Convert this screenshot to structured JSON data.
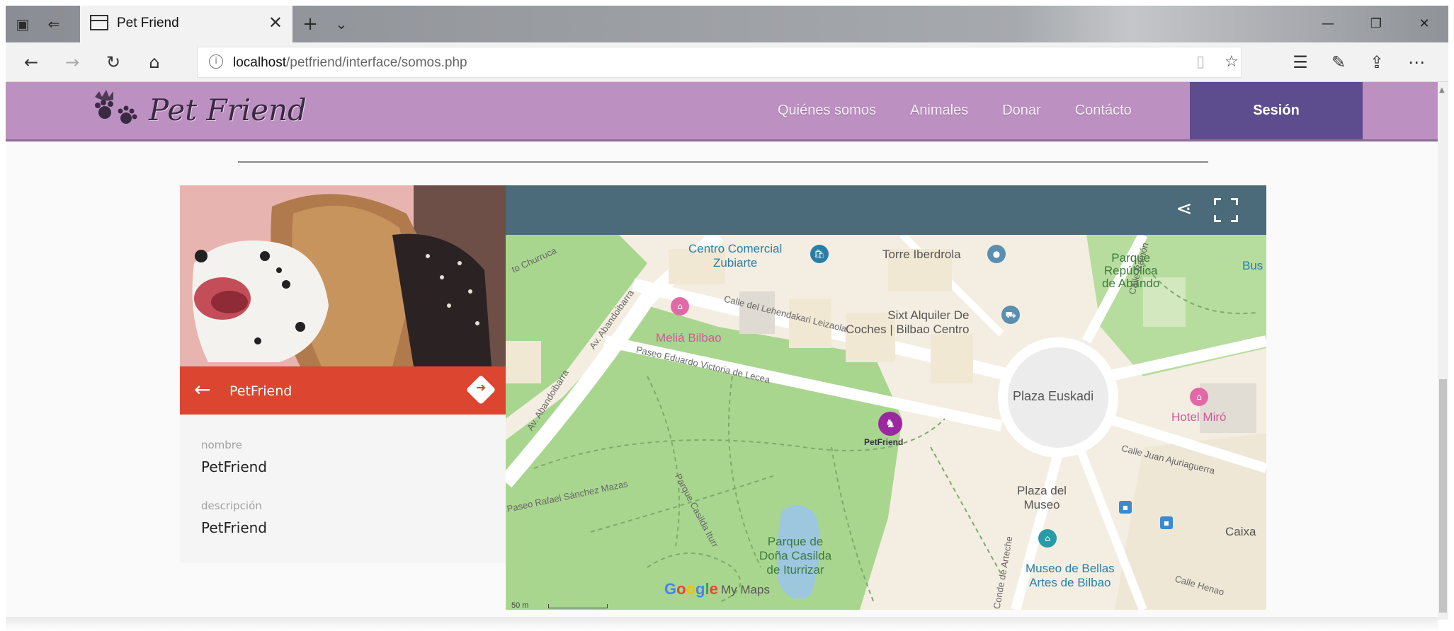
{
  "browser": {
    "tab_title": "Pet Friend",
    "tab_close": "✕",
    "new_tab": "+",
    "tab_menu": "⌄",
    "window_controls": [
      "—",
      "❐",
      "✕"
    ],
    "url_host": "localhost",
    "url_path": "/petfriend/interface/somos.php",
    "icons": [
      "back-icon",
      "forward-icon",
      "refresh-icon",
      "home-icon",
      "info-icon",
      "reading-view-icon",
      "favorite-star-icon",
      "favorites-icon",
      "pen-icon",
      "share-icon",
      "more-icon"
    ]
  },
  "site": {
    "logo_text": "Pet Friend",
    "nav": [
      "Quiénes somos",
      "Animales",
      "Donar",
      "Contácto"
    ],
    "session_button": "Sesión",
    "header_color": "#bd90c2",
    "session_color": "#5e4d8e"
  },
  "place_panel": {
    "title": "PetFriend",
    "fields": [
      {
        "label": "nombre",
        "value": "PetFriend"
      },
      {
        "label": "descripción",
        "value": "PetFriend"
      }
    ],
    "bar_color": "#dc4530"
  },
  "map": {
    "toolbar_color": "#4b6a7a",
    "labels": {
      "centro": "Centro Comercial\nZubiarte",
      "torre": "Torre Iberdrola",
      "parque_rep": "Parque\nRepública\nde Abando",
      "bus": "Bus T",
      "sixt": "Sixt Alquiler De\nCoches | Bilbao Centro",
      "melia": "Meliá Bilbao",
      "plaza_euskadi": "Plaza Euskadi",
      "hotel_miro": "Hotel Miró",
      "petfriend_marker": "PetFriend",
      "plaza_museo": "Plaza del\nMuseo",
      "caixa": "Caixa",
      "parque_dona": "Parque de\nDoña Casilda\nde Iturrizar",
      "museo": "Museo de Bellas\nArtes de Bilbao",
      "st_churruca": "to Churruca",
      "st_lehendakari": "Calle del Lehendakari Leizaola",
      "st_paseo_eduardo": "Paseo Eduardo Victoria de Lecea",
      "st_abandoibarra": "Av. Abandoibarra",
      "st_abandoibarra2": "Av. Abandoibarra",
      "st_rafael": "Paseo Rafael Sánchez Mazas",
      "st_parque_casilda": "Parque Casilda Iturr",
      "st_ajuriaguerra": "Calle Juan Ajuriaguerra",
      "st_henao": "Calle Henao",
      "st_arteche": "Conde de Arteche",
      "st_ramon": "Calle Ramón"
    },
    "google": "Google",
    "my_maps": "My Maps",
    "scale": "50 m"
  }
}
